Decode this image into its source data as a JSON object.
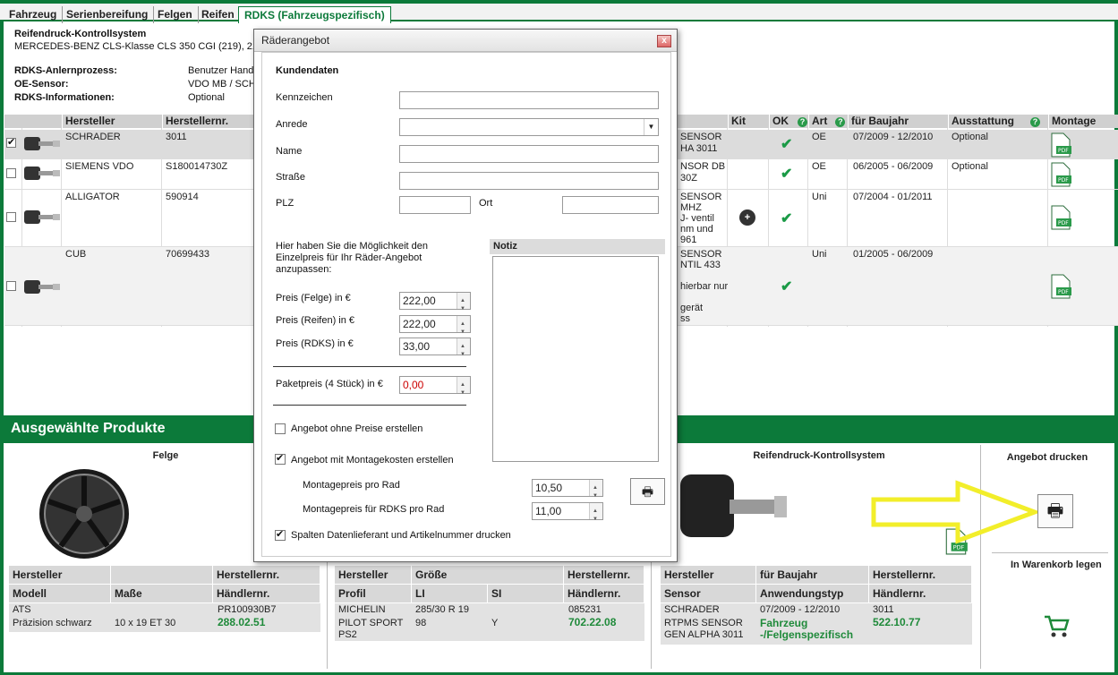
{
  "tabs": [
    "Fahrzeug",
    "Serienbereifung",
    "Felgen",
    "Reifen",
    "RDKS (Fahrzeugspezifisch)"
  ],
  "header": {
    "title": "Reifendruck-Kontrollsystem",
    "vehicle": "MERCEDES-BENZ CLS-Klasse CLS 350 CGI (219), 21",
    "anlern_label": "RDKS-Anlernprozess:",
    "anlern_value": "Benutzer Hand",
    "oe_label": "OE-Sensor:",
    "oe_value": "VDO MB / SCH",
    "info_label": "RDKS-Informationen:",
    "info_value": "Optional"
  },
  "table": {
    "headers_left": [
      "Hersteller",
      "Herstellernr."
    ],
    "headers_right": [
      "Kit",
      "OK",
      "Art",
      "für Baujahr",
      "Ausstattung",
      "Montage"
    ],
    "rows": [
      {
        "checked": true,
        "maker": "SCHRADER",
        "nr": "3011",
        "desc": "SENSOR\nHA 3011",
        "kit": "",
        "ok": true,
        "art": "OE",
        "year": "07/2009 - 12/2010",
        "equip": "Optional"
      },
      {
        "checked": false,
        "maker": "SIEMENS VDO",
        "nr": "S180014730Z",
        "desc": "NSOR DB\n30Z",
        "kit": "",
        "ok": true,
        "art": "OE",
        "year": "06/2005 - 06/2009",
        "equip": "Optional"
      },
      {
        "checked": false,
        "maker": "ALLIGATOR",
        "nr": "590914",
        "desc": "SENSOR\nMHZ\nJ- ventil\nnm und\n961",
        "kit": "+",
        "ok": true,
        "art": "Uni",
        "year": "07/2004 - 01/2011",
        "equip": ""
      },
      {
        "checked": false,
        "maker": "CUB",
        "nr": "70699433",
        "desc": "SENSOR\nNTIL 433\n\nhierbar nur\n\ngerät\nss",
        "kit": "",
        "ok": true,
        "art": "Uni",
        "year": "01/2005 - 06/2009",
        "equip": ""
      }
    ]
  },
  "selected": {
    "title": "Ausgewählte Produkte",
    "felge": "Felge",
    "rdks": "Reifendruck-Kontrollsystem",
    "print": "Angebot drucken",
    "cart": "In Warenkorb legen",
    "felge_table": {
      "h1": [
        "Hersteller",
        "",
        "Herstellernr."
      ],
      "h2": [
        "Modell",
        "Maße",
        "Händlernr."
      ],
      "maker": "ATS",
      "nr": "PR100930B7",
      "model": "Präzision schwarz",
      "size": "10 x 19 ET 30",
      "price": "288.02.51"
    },
    "tire_table": {
      "h1": [
        "Hersteller",
        "Größe",
        "Herstellernr."
      ],
      "h2": [
        "Profil",
        "LI",
        "SI",
        "Händlernr."
      ],
      "maker": "MICHELIN",
      "size": "285/30 R 19",
      "nr": "085231",
      "profil": "PILOT SPORT\nPS2",
      "li": "98",
      "si": "Y",
      "price": "702.22.08"
    },
    "rdks_table": {
      "h1": [
        "Hersteller",
        "für Baujahr",
        "Herstellernr."
      ],
      "h2": [
        "Sensor",
        "Anwendungstyp",
        "Händlernr."
      ],
      "maker": "SCHRADER",
      "year": "07/2009 - 12/2010",
      "nr": "3011",
      "sensor": "RTPMS SENSOR\nGEN ALPHA 3011",
      "type": "Fahrzeug\n-/Felgenspezifisch",
      "price": "522.10.77"
    }
  },
  "dialog": {
    "title": "Räderangebot",
    "close": "x",
    "section": "Kundendaten",
    "kennzeichen": "Kennzeichen",
    "anrede": "Anrede",
    "name": "Name",
    "strasse": "Straße",
    "plz": "PLZ",
    "ort": "Ort",
    "info": "Hier haben Sie die Möglichkeit den\nEinzelpreis für Ihr Räder-Angebot\nanzupassen:",
    "notiz": "Notiz",
    "preis_felge_label": "Preis (Felge) in €",
    "preis_felge": "222,00",
    "preis_reifen_label": "Preis (Reifen) in €",
    "preis_reifen": "222,00",
    "preis_rdks_label": "Preis (RDKS) in €",
    "preis_rdks": "33,00",
    "paket_label": "Paketpreis (4 Stück)  in €",
    "paket": "0,00",
    "opt1": "Angebot ohne Preise erstellen",
    "opt2": "Angebot mit Montagekosten erstellen",
    "montage_rad_label": "Montagepreis pro Rad",
    "montage_rad": "10,50",
    "montage_rdks_label": "Montagepreis für RDKS pro Rad",
    "montage_rdks": "11,00",
    "opt3": "Spalten Datenlieferant und Artikelnummer drucken",
    "opt1_checked": false,
    "opt2_checked": true,
    "opt3_checked": true
  },
  "colors": {
    "green": "#0c7a3a",
    "price": "#1f8a3a",
    "red": "#cc0000"
  }
}
